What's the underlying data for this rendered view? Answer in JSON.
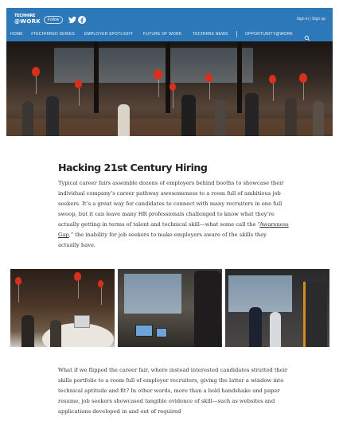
{
  "header": {
    "logo_line1": "TECHHIRE",
    "logo_line2": "@WORK",
    "follow_label": "Follow",
    "sign_in": "Sign in",
    "separator": "|",
    "sign_up": "Sign up",
    "colors": {
      "bar": "#2d78b8",
      "text": "#ffffff"
    },
    "icons": [
      "twitter-icon",
      "facebook-icon",
      "search-icon"
    ]
  },
  "nav": {
    "items": [
      "HOME",
      "#TECHHIRED SERIES",
      "EMPLOYER SPOTLIGHT",
      "FUTURE OF WORK",
      "TECHHIRE NEWS",
      "OPPORTUNITY@WORK"
    ]
  },
  "article": {
    "title": "Hacking 21st Century Hiring",
    "para1_before_link": "Typical career fairs assemble dozens of employers behind booths to showcase their individual company’s career pathway awesomeness to a room full of ambitious job seekers. It’s a great way for candidates to connect with many recruiters in one full swoop, but it can leave many HR professionals challenged to know what they’re actually getting in terms of talent and technical skill—what some call the “",
    "para1_link": "Awareness Gap",
    "para1_after_link": ",” the inability for job seekers to make employers aware of the skills they actually have.",
    "para2": "What if we flipped the career fair, where instead interested candidates strutted their skills portfolio to a room full of employer recruiters, giving the latter a window into technical aptitude and fit? In other words, more than a bold handshake and paper resume, job seekers showcased tangible evidence of skill—such as websites and applications developed in and out of required"
  }
}
